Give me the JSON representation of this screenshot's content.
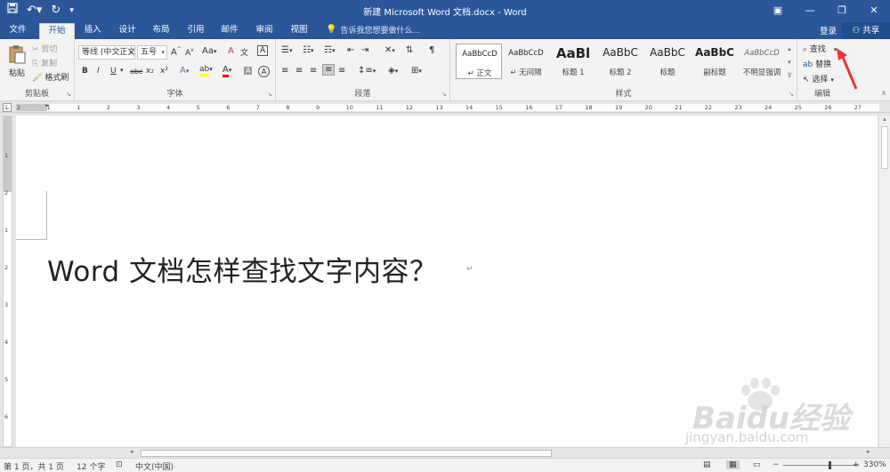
{
  "window": {
    "title": "新建 Microsoft Word 文档.docx - Word"
  },
  "quick_access": {
    "save_icon": "save-icon",
    "undo_icon": "undo-icon",
    "redo_icon": "redo-icon",
    "customize_icon": "customize-icon"
  },
  "tabs": [
    {
      "label": "文件"
    },
    {
      "label": "开始"
    },
    {
      "label": "插入"
    },
    {
      "label": "设计"
    },
    {
      "label": "布局"
    },
    {
      "label": "引用"
    },
    {
      "label": "邮件"
    },
    {
      "label": "审阅"
    },
    {
      "label": "视图"
    }
  ],
  "tell_me": "告诉我您想要做什么...",
  "account": {
    "login": "登录",
    "share": "共享"
  },
  "clipboard": {
    "paste": "粘贴",
    "cut": "剪切",
    "copy": "复制",
    "format_painter": "格式刷",
    "label": "剪贴板"
  },
  "font": {
    "name": "等线 (中文正文",
    "size": "五号",
    "label": "字体",
    "grow": "A",
    "shrink": "A",
    "case": "Aa",
    "clear": "A",
    "char_border": "A",
    "bold": "B",
    "italic": "I",
    "underline": "U",
    "strike": "abc",
    "subscript": "x₂",
    "superscript": "x²",
    "effects": "A",
    "highlight": "ab",
    "color": "A",
    "shade": "A",
    "enclose": "A"
  },
  "paragraph": {
    "label": "段落"
  },
  "styles": {
    "label": "样式",
    "items": [
      {
        "sample": "AaBbCcD",
        "name": "↵ 正文"
      },
      {
        "sample": "AaBbCcD",
        "name": "↵ 无间隔"
      },
      {
        "sample": "AaBl",
        "name": "标题 1"
      },
      {
        "sample": "AaBbC",
        "name": "标题 2"
      },
      {
        "sample": "AaBbC",
        "name": "标题"
      },
      {
        "sample": "AaBbC",
        "name": "副标题"
      },
      {
        "sample": "AaBbCcD",
        "name": "不明显强调"
      }
    ]
  },
  "editing": {
    "find": "查找",
    "replace": "替换",
    "select": "选择",
    "label": "编辑"
  },
  "ruler": {
    "ticks": [
      "2",
      "1",
      "1",
      "2",
      "3",
      "4",
      "5",
      "6",
      "7",
      "8",
      "9",
      "10",
      "11",
      "12",
      "13",
      "14",
      "15",
      "16",
      "17",
      "18",
      "19",
      "20",
      "21",
      "22",
      "23",
      "24",
      "25",
      "26",
      "27"
    ]
  },
  "vruler": {
    "ticks": [
      "1",
      "2",
      "1",
      "2",
      "3",
      "4",
      "5",
      "6"
    ]
  },
  "document": {
    "heading": "Word 文档怎样查找文字内容？",
    "paragraph_mark": "↵"
  },
  "statusbar": {
    "page": "第 1 页，共 1 页",
    "words": "12 个字",
    "language": "中文(中国)",
    "zoom": "330%"
  },
  "watermark": {
    "brand": "Baidu经验",
    "url": "jingyan.baidu.com"
  },
  "colors": {
    "title_bar": "#2b579a",
    "ribbon": "#f3f3f3",
    "annotation_arrow": "#e53935",
    "highlight_yellow": "#ffff00",
    "font_red": "#ff0000"
  }
}
